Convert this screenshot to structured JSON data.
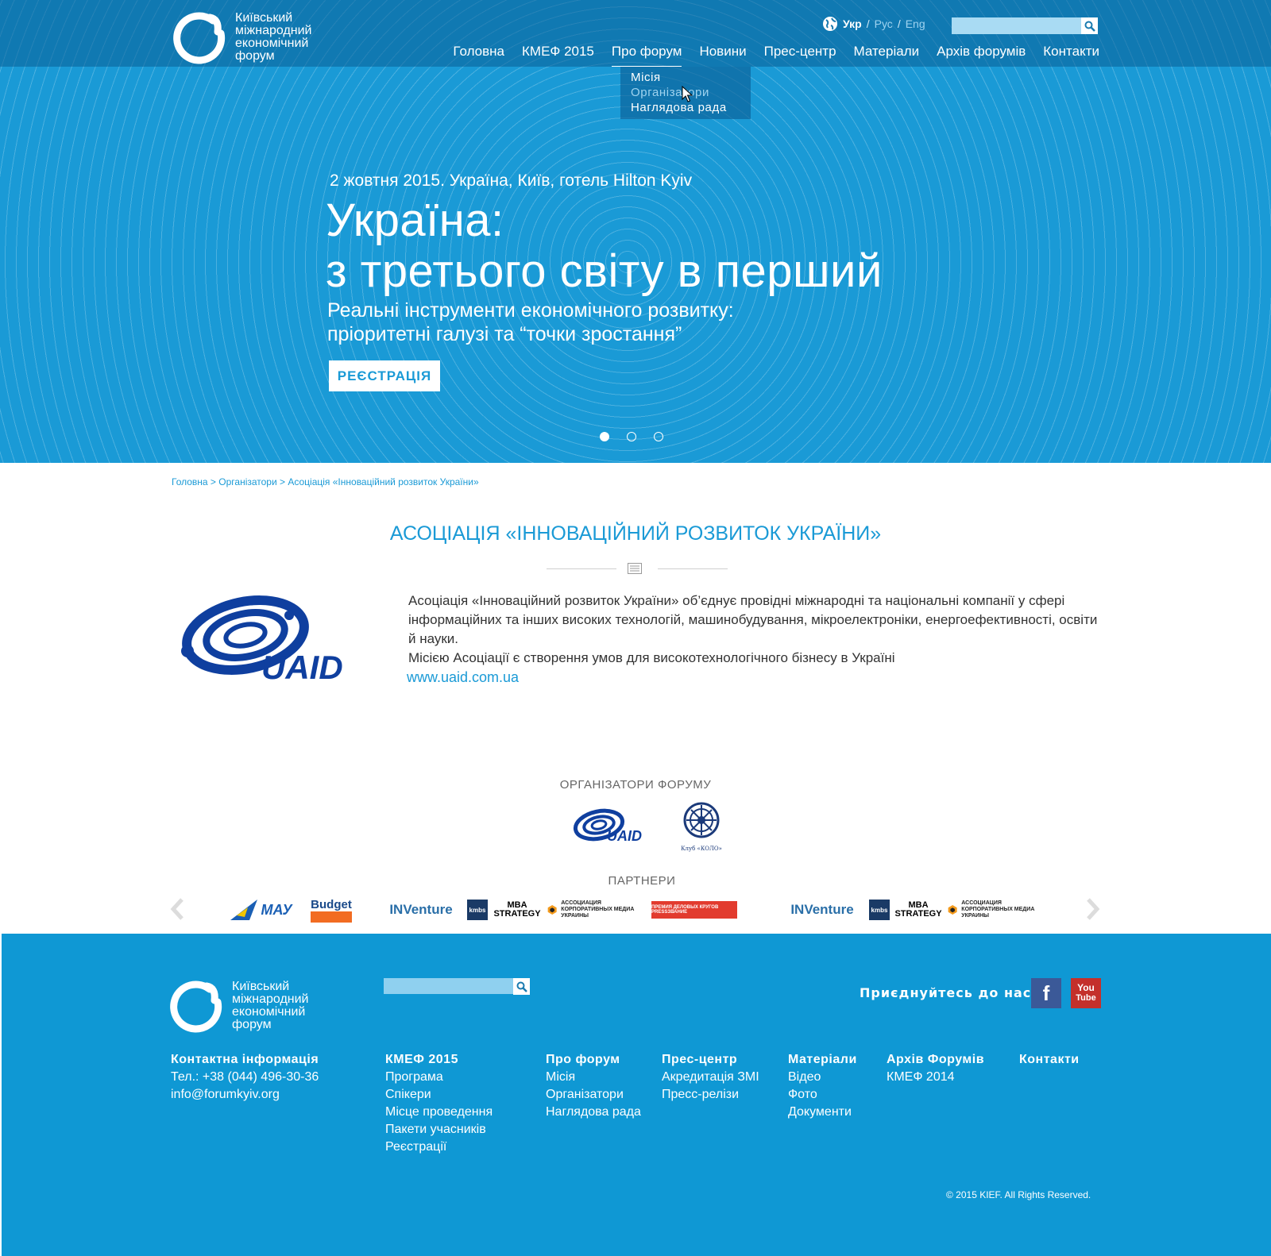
{
  "colors": {
    "brand_blue": "#1a9ad6",
    "footer_blue": "#0f98d4",
    "uaid_blue": "#0f3f9f"
  },
  "logo": {
    "text": "Київський\nміжнародний\nекономічний\nфорум"
  },
  "lang": {
    "active": "Укр",
    "sep1": "/",
    "ru": "Рус",
    "sep2": "/",
    "en": "Eng"
  },
  "nav": [
    "Головна",
    "КМЕФ 2015",
    "Про форум",
    "Новини",
    "Прес-центр",
    "Матеріали",
    "Архів форумів",
    "Контакти"
  ],
  "dropdown": [
    "Місія",
    "Організатори",
    "Наглядова рада"
  ],
  "hero": {
    "date": "2 жовтня 2015. Україна, Київ, готель Hilton Kyiv",
    "title_line1": "Україна:",
    "title_line2": "з третього світу в перший",
    "sub_line1": "Реальні інструменти економічного розвитку:",
    "sub_line2": "пріоритетні галузі та “точки зростання”",
    "register": "РЕЄСТРАЦІЯ",
    "slides_total": 3,
    "slide_active": 1
  },
  "breadcrumb": "Головна > Організатори > Асоціація «Інноваційний розвиток України»",
  "page_title": "АСОЦІАЦІЯ «ІННОВАЦІЙНИЙ РОЗВИТОК УКРАЇНИ»",
  "org": {
    "logo_text": "UAID",
    "desc1": "Асоціація «Інноваційний розвиток України» об’єднує провідні міжнародні та національні компанії у сфері інформаційних та інших високих технологій, машинобудування, мікроелектроніки, енергоефективності, освіти й науки.",
    "desc2": "Місією Асоціації є створення умов для високотехнологічного бізнесу в Україні",
    "link": "www.uaid.com.ua"
  },
  "organizers": {
    "heading": "ОРГАНІЗАТОРИ ФОРУМУ",
    "uaid": "UAID",
    "kolo": "Клуб «КОЛО»"
  },
  "partners": {
    "heading": "ПАРТНЕРИ",
    "items": [
      "МАУ",
      "Budget",
      "INVenture",
      "kmbs",
      "MBA STRATEGY",
      "АССОЦИАЦИЯ КОРПОРАТИВНЫХ МЕДИА УКРАИНЫ",
      "ПРЕМИЯ ДЕЛОВЫХ КРУГОВ PRESSЗВАНИЕ",
      "INVenture",
      "kmbs",
      "MBA STRATEGY",
      "АССОЦИАЦИЯ КОРПОРАТИВНЫХ МЕДИА УКРАИНЫ"
    ]
  },
  "footer": {
    "join": "Приєднуйтесь до нас:",
    "facebook": "f",
    "youtube_top": "You",
    "youtube_bottom": "Tube",
    "contact": {
      "head": "Контактна  інформація",
      "phone": "Тел.: +38 (044) 496-30-36",
      "email": "info@forumkyiv.org"
    },
    "cols": [
      {
        "head": "КМЕФ 2015",
        "links": [
          "Програма",
          "Спікери",
          "Місце проведення",
          "Пакети учасників",
          "Реєстрації"
        ]
      },
      {
        "head": "Про форум",
        "links": [
          "Місія",
          "Організатори",
          "Наглядова рада"
        ]
      },
      {
        "head": "Прес-центр",
        "links": [
          "Акредитація ЗМІ",
          "Пресс-релізи"
        ]
      },
      {
        "head": "Матеріали",
        "links": [
          "Відео",
          "Фото",
          "Документи"
        ]
      },
      {
        "head": "Архів Форумів",
        "links": [
          "КМЕФ 2014"
        ]
      },
      {
        "head": "Контакти",
        "links": []
      }
    ],
    "copyright": "© 2015 KIEF. All Rights Reserved."
  }
}
